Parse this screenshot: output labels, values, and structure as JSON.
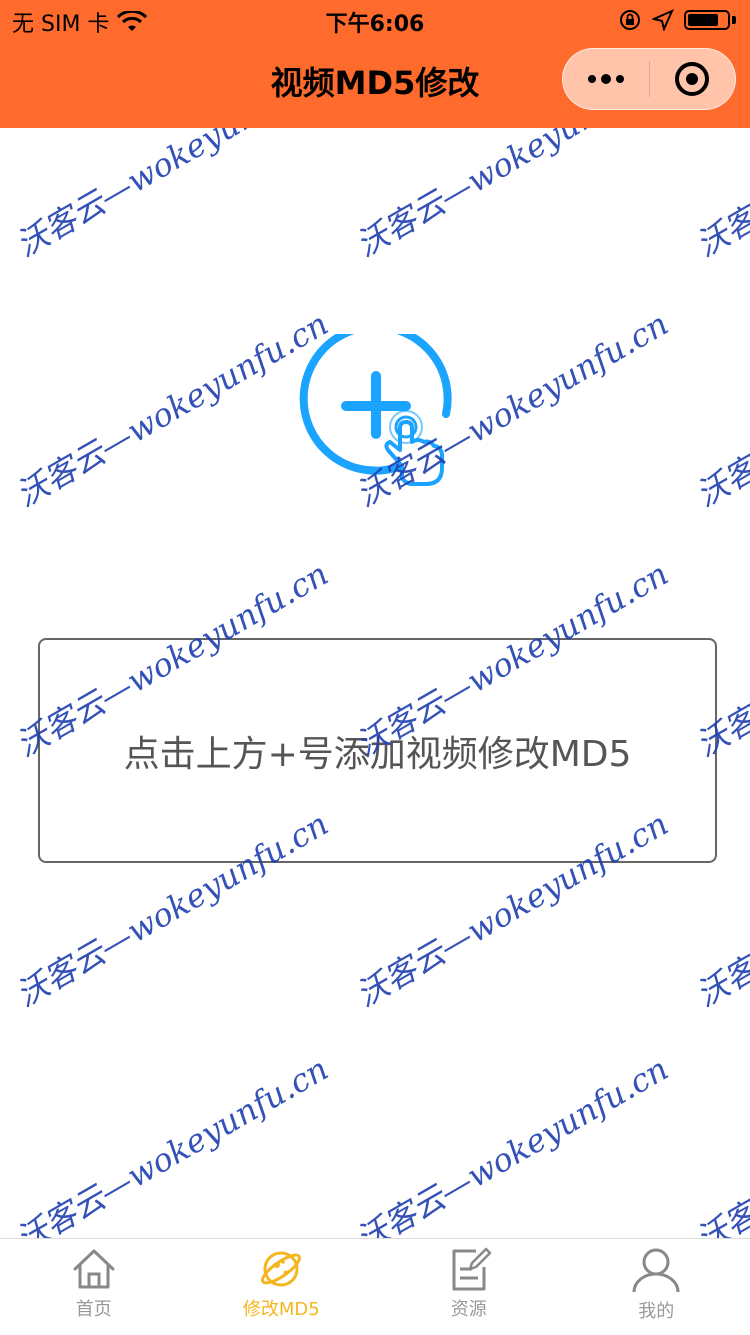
{
  "status_bar": {
    "carrier": "无 SIM 卡",
    "time": "下午6:06"
  },
  "nav": {
    "title": "视频MD5修改",
    "more_icon": "more-dots-icon",
    "close_icon": "target-circle-icon"
  },
  "watermark": {
    "text": "沃客云—wokeyunfu.cn"
  },
  "main": {
    "add_icon": "plus-circle-tap-icon",
    "prompt": "点击上方+号添加视频修改MD5"
  },
  "tabs": [
    {
      "label": "首页",
      "icon": "home-icon",
      "active": false
    },
    {
      "label": "修改MD5",
      "icon": "planet-icon",
      "active": true
    },
    {
      "label": "资源",
      "icon": "edit-note-icon",
      "active": false
    },
    {
      "label": "我的",
      "icon": "user-icon",
      "active": false
    }
  ],
  "colors": {
    "header": "#ff6b2c",
    "accent": "#1aa3ff",
    "tab_active": "#f5b51f",
    "watermark": "#1f3fb0"
  }
}
